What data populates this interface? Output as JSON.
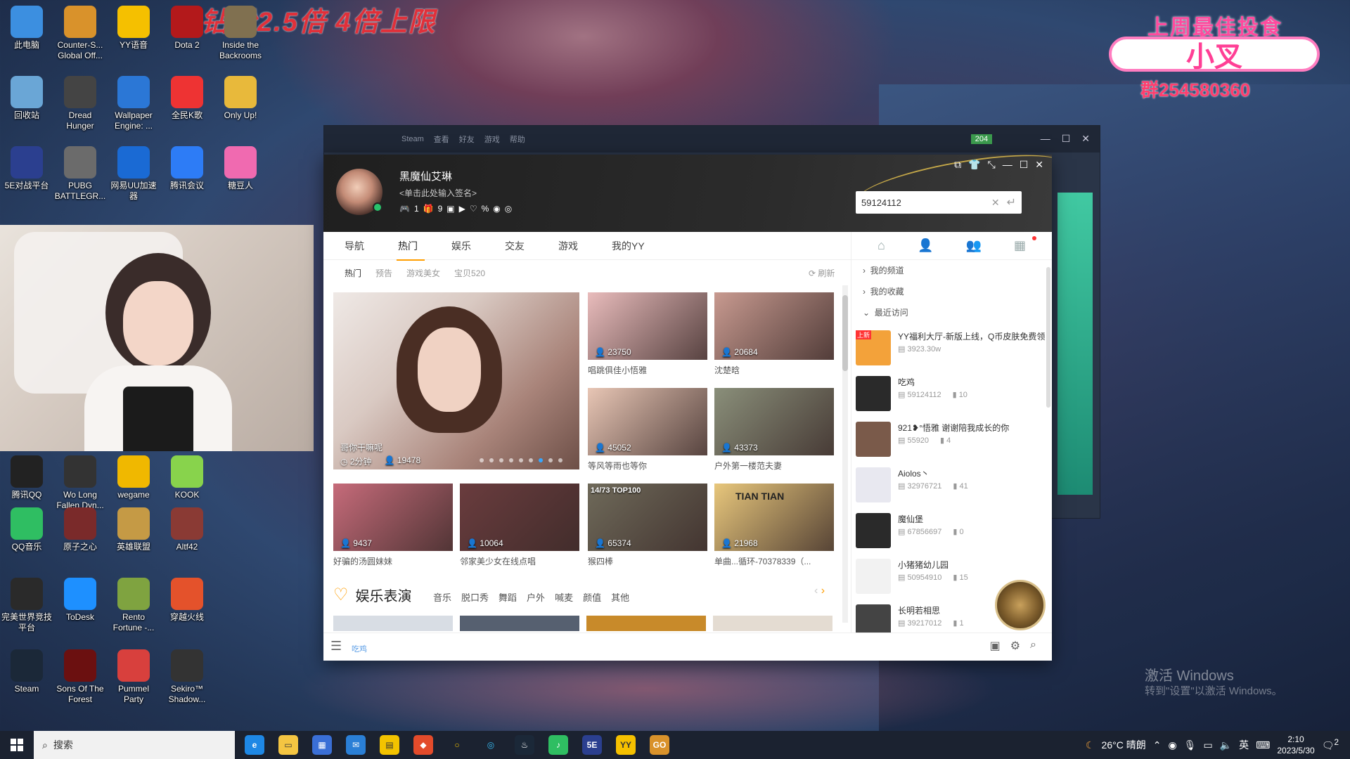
{
  "overlay": {
    "top_text": "钻粉2.5倍 4倍上限",
    "promo_title": "上周最佳投食",
    "promo_name": "小叉",
    "promo_qq": "群254580360"
  },
  "desktop_icons": [
    {
      "label": "此电脑",
      "icon": "computer-icon",
      "color": "#3c8fe0"
    },
    {
      "label": "Counter-S... Global Off...",
      "icon": "csgo-icon",
      "color": "#d9922b"
    },
    {
      "label": "YY语音",
      "icon": "yy-icon",
      "color": "#f5c000"
    },
    {
      "label": "Dota 2",
      "icon": "dota2-icon",
      "color": "#b3191b"
    },
    {
      "label": "Inside the Backrooms",
      "icon": "backrooms-icon",
      "color": "#807050"
    },
    {
      "label": "回收站",
      "icon": "recycle-bin-icon",
      "color": "#6aa6d6"
    },
    {
      "label": "Dread Hunger",
      "icon": "anchor-icon",
      "color": "#444"
    },
    {
      "label": "Wallpaper Engine: ...",
      "icon": "wallpaper-engine-icon",
      "color": "#2b77d6"
    },
    {
      "label": "全民K歌",
      "icon": "kge-icon",
      "color": "#e33"
    },
    {
      "label": "Only Up!",
      "icon": "onlyup-icon",
      "color": "#e8b93b"
    },
    {
      "label": "5E对战平台",
      "icon": "5e-icon",
      "color": "#2b3f8f"
    },
    {
      "label": "PUBG BATTLEGR...",
      "icon": "pubg-icon",
      "color": "#6b6b6b"
    },
    {
      "label": "网易UU加速器",
      "icon": "uu-icon",
      "color": "#1a6ad4"
    },
    {
      "label": "腾讯会议",
      "icon": "tencent-meeting-icon",
      "color": "#2d7cf6"
    },
    {
      "label": "糖豆人",
      "icon": "fallguys-icon",
      "color": "#f06ab0"
    },
    {
      "label": "腾讯QQ",
      "icon": "qq-icon",
      "color": "#222"
    },
    {
      "label": "Wo Long Fallen Dyn...",
      "icon": "wolong-icon",
      "color": "#333"
    },
    {
      "label": "wegame",
      "icon": "wegame-icon",
      "color": "#f0b800"
    },
    {
      "label": "KOOK",
      "icon": "kook-icon",
      "color": "#88d34c"
    },
    {
      "label": "QQ音乐",
      "icon": "qqmusic-icon",
      "color": "#2fbe62"
    },
    {
      "label": "原子之心",
      "icon": "atomicheart-icon",
      "color": "#7a2a2a"
    },
    {
      "label": "英雄联盟",
      "icon": "lol-icon",
      "color": "#c59a45"
    },
    {
      "label": "Altf42",
      "icon": "altf42-icon",
      "color": "#8a3a34"
    },
    {
      "label": "完美世界竞技平台",
      "icon": "perfectworld-icon",
      "color": "#2a2a2a"
    },
    {
      "label": "ToDesk",
      "icon": "todesk-icon",
      "color": "#1e90ff"
    },
    {
      "label": "Rento Fortune -...",
      "icon": "rento-icon",
      "color": "#7fa340"
    },
    {
      "label": "穿越火线",
      "icon": "crossfire-icon",
      "color": "#e4522b"
    },
    {
      "label": "Steam",
      "icon": "steam-icon",
      "color": "#1b2838"
    },
    {
      "label": "Sons Of The Forest",
      "icon": "sotf-icon",
      "color": "#6b1010"
    },
    {
      "label": "Pummel Party",
      "icon": "pummel-icon",
      "color": "#d8403d"
    },
    {
      "label": "Sekiro™ Shadow...",
      "icon": "sekiro-icon",
      "color": "#333"
    }
  ],
  "yy_back": {
    "menu": [
      "Steam",
      "查看",
      "好友",
      "游戏",
      "帮助"
    ],
    "badge": "204"
  },
  "yy": {
    "username": "黑魔仙艾琳",
    "signature": "<单击此处输入签名>",
    "badges": [
      "1",
      "9"
    ],
    "search_value": "59124112",
    "tabs": [
      "导航",
      "热门",
      "娱乐",
      "交友",
      "游戏",
      "我的YY"
    ],
    "active_tab": "热门",
    "subtabs": [
      "热门",
      "预告",
      "游戏美女",
      "宝贝520"
    ],
    "refresh": "刷新",
    "big_card": {
      "title": "哥你干嘛呢",
      "duration": "2分钟",
      "viewers": "19478"
    },
    "cards": [
      {
        "viewers": "23750",
        "caption": "唱跳俱佳小悟雅",
        "color": "#e9bcbc"
      },
      {
        "viewers": "20684",
        "caption": "沈楚晗",
        "color": "#c89a90"
      },
      {
        "viewers": "45052",
        "caption": "等风等雨也等你",
        "color": "#e8c6b5"
      },
      {
        "viewers": "43373",
        "caption": "户外第一楼范夫妻",
        "color": "#8a8f7a"
      },
      {
        "viewers": "9437",
        "caption": "好骗的汤圆妹妹",
        "color": "#c66b7a"
      },
      {
        "viewers": "10064",
        "caption": "邻家美少女在线点唱",
        "color": "#6a3c3e"
      },
      {
        "viewers": "65374",
        "caption": "猴四棒",
        "color": "#6f6a5a"
      },
      {
        "viewers": "21968",
        "caption": "单曲...循环-70378339（...",
        "color": "#e8c77c"
      }
    ],
    "game_overlay": "14/73 TOP100",
    "card_overlay": "TIAN TIAN",
    "section_title": "娱乐表演",
    "section_links": [
      "音乐",
      "脱口秀",
      "舞蹈",
      "户外",
      "喊麦",
      "颜值",
      "其他"
    ],
    "bottom_text": "吃鸡",
    "right_panel": {
      "folders": [
        "我的频道",
        "我的收藏",
        "最近访问"
      ],
      "recent": [
        {
          "name": "YY福利大厅-新版上线，Q币皮肤免费领",
          "id": "3923.30w",
          "count": "",
          "thumb_color": "#f3a23a",
          "tag": "上新"
        },
        {
          "name": "吃鸡",
          "id": "59124112",
          "count": "10",
          "thumb_color": "#2a2a2a",
          "tag": ""
        },
        {
          "name": "921❥°悟雅 谢谢陪我成长的你",
          "id": "55920",
          "count": "4",
          "thumb_color": "#7a5a4a",
          "tag": ""
        },
        {
          "name": "Aiolos丶",
          "id": "32976721",
          "count": "41",
          "thumb_color": "#e8e8f0",
          "tag": ""
        },
        {
          "name": "魔仙堡",
          "id": "67856697",
          "count": "0",
          "thumb_color": "#2a2a2a",
          "tag": ""
        },
        {
          "name": "小猪猪幼儿园",
          "id": "50954910",
          "count": "15",
          "thumb_color": "#f2f2f2",
          "tag": ""
        },
        {
          "name": "长明若相思",
          "id": "39217012",
          "count": "1",
          "thumb_color": "#444",
          "tag": ""
        }
      ]
    }
  },
  "activate": {
    "line1": "激活 Windows",
    "line2": "转到\"设置\"以激活 Windows。"
  },
  "taskbar": {
    "search": "搜索",
    "weather": "26°C 晴朗",
    "ime": "英",
    "time": "2:10",
    "date": "2023/5/30",
    "notif": "2"
  }
}
